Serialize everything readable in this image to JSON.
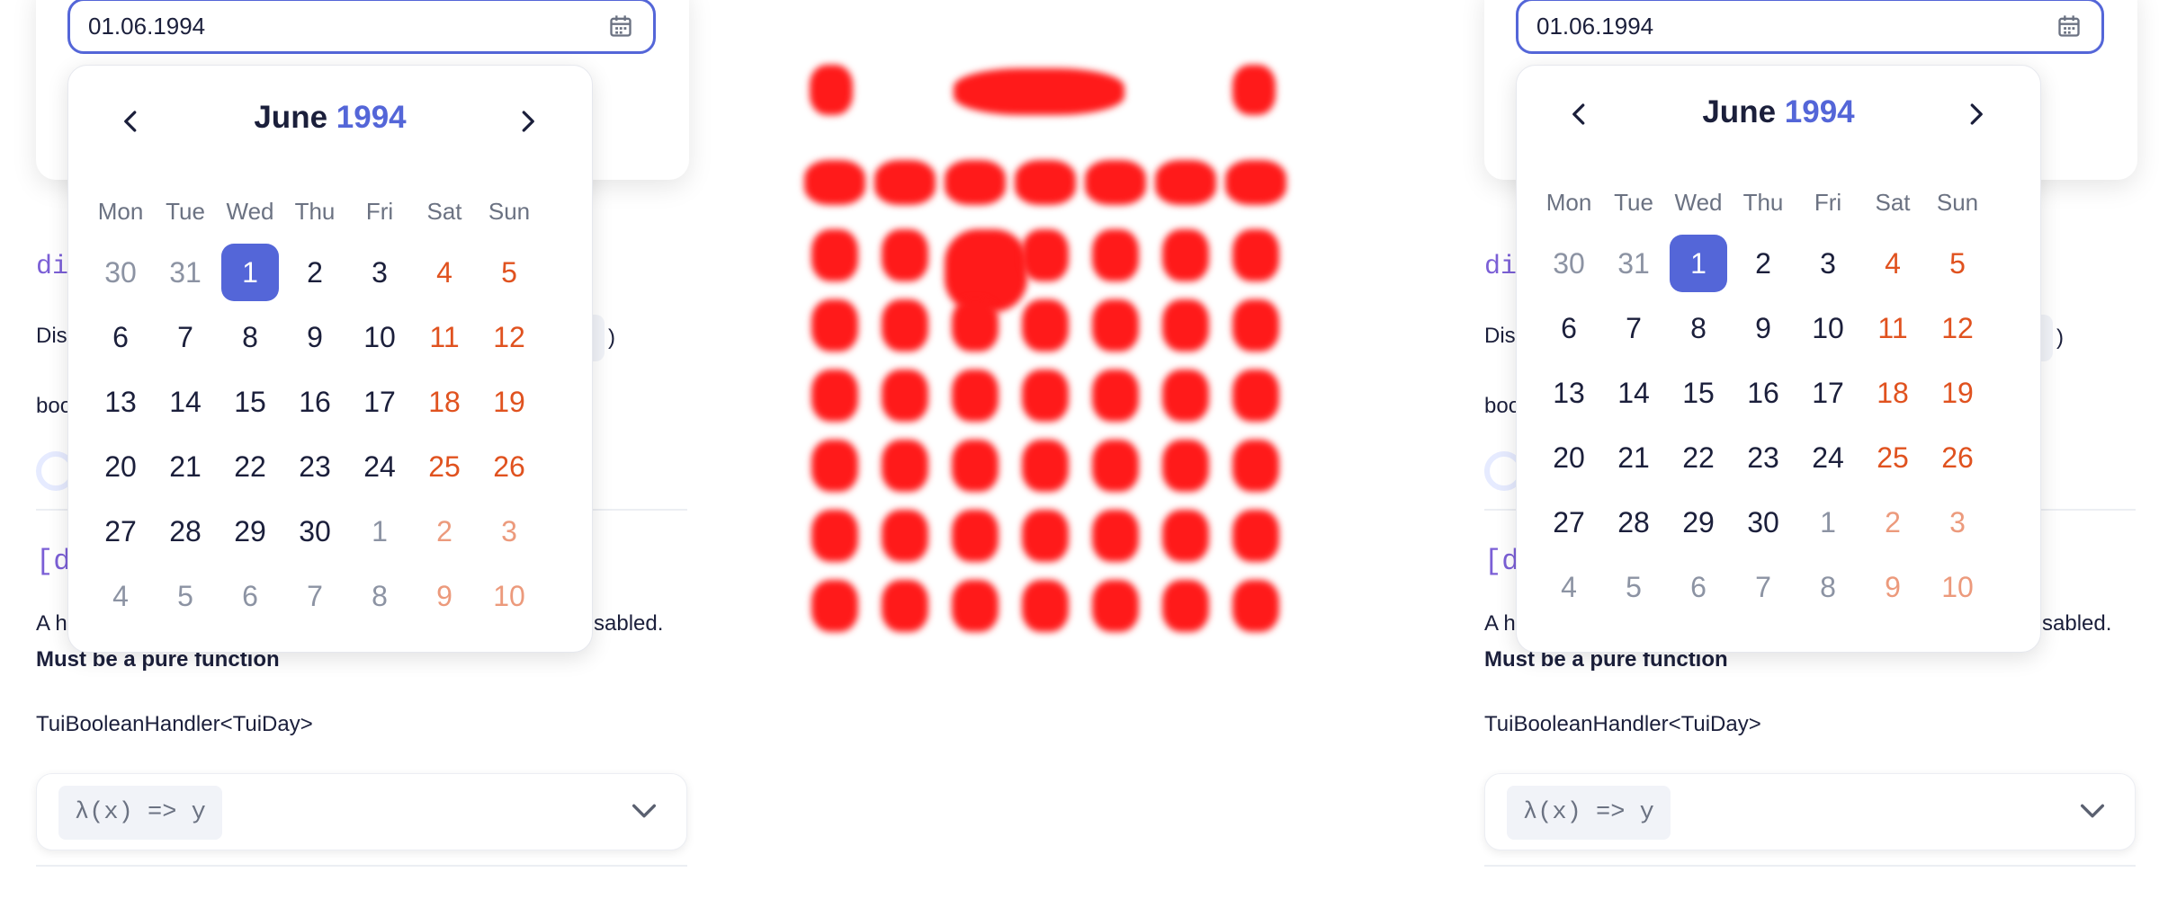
{
  "date_value": "01.06.1994",
  "calendar": {
    "month": "June",
    "year": "1994",
    "weekdays": [
      "Mon",
      "Tue",
      "Wed",
      "Thu",
      "Fri",
      "Sat",
      "Sun"
    ],
    "weeks": [
      [
        "30",
        "31",
        "1",
        "2",
        "3",
        "4",
        "5"
      ],
      [
        "6",
        "7",
        "8",
        "9",
        "10",
        "11",
        "12"
      ],
      [
        "13",
        "14",
        "15",
        "16",
        "17",
        "18",
        "19"
      ],
      [
        "20",
        "21",
        "22",
        "23",
        "24",
        "25",
        "26"
      ],
      [
        "27",
        "28",
        "29",
        "30",
        "1",
        "2",
        "3"
      ],
      [
        "4",
        "5",
        "6",
        "7",
        "8",
        "9",
        "10"
      ]
    ],
    "selected": "1"
  },
  "doc": {
    "prop_name_fragment": "di",
    "desc_fragment": "Dis",
    "paren": ")",
    "type_fragment": "boo",
    "attr_fragment": "[d",
    "handler_desc_prefix": "A h",
    "handler_desc_suffix": "sabled.",
    "must_be_pure": "Must be a pure function",
    "handler_type": "TuiBooleanHandler<TuiDay>",
    "select_value": "λ(x) => y"
  },
  "colors": {
    "accent": "#5466d8",
    "weekend": "#e0521f",
    "diff_mask": "#ff1a1a"
  }
}
